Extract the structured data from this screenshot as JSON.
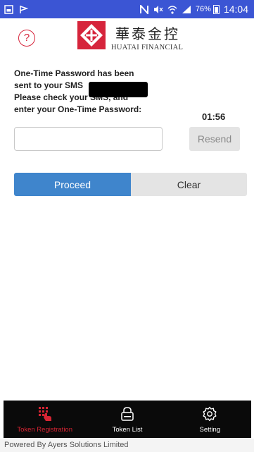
{
  "status_bar": {
    "left_icons": [
      "gallery-icon",
      "flag-icon"
    ],
    "right_icons": [
      "nfc-icon",
      "mute-icon",
      "wifi-icon",
      "signal-icon"
    ],
    "battery": "76%",
    "time": "14:04",
    "background": "#3b55d4"
  },
  "header": {
    "help_symbol": "?",
    "logo_chinese": "華泰金控",
    "logo_english": "HUATAI FINANCIAL",
    "brand_color": "#d6243b"
  },
  "otp": {
    "line1": "One-Time Password has been",
    "line2": "sent to your SMS",
    "line3": "Please check your SMS, and",
    "line4": "enter your One-Time Password:",
    "countdown": "01:56",
    "input_value": "",
    "input_placeholder": "",
    "resend_label": "Resend"
  },
  "actions": {
    "proceed_label": "Proceed",
    "clear_label": "Clear",
    "proceed_color": "#3f85cc"
  },
  "bottom_nav": {
    "items": [
      {
        "label": "Token Registration",
        "icon": "token-registration-icon",
        "active": true
      },
      {
        "label": "Token List",
        "icon": "lock-icon",
        "active": false
      },
      {
        "label": "Setting",
        "icon": "gear-icon",
        "active": false
      }
    ],
    "active_color": "#d62433"
  },
  "footer": {
    "powered_by": "Powered By Ayers Solutions Limited"
  }
}
